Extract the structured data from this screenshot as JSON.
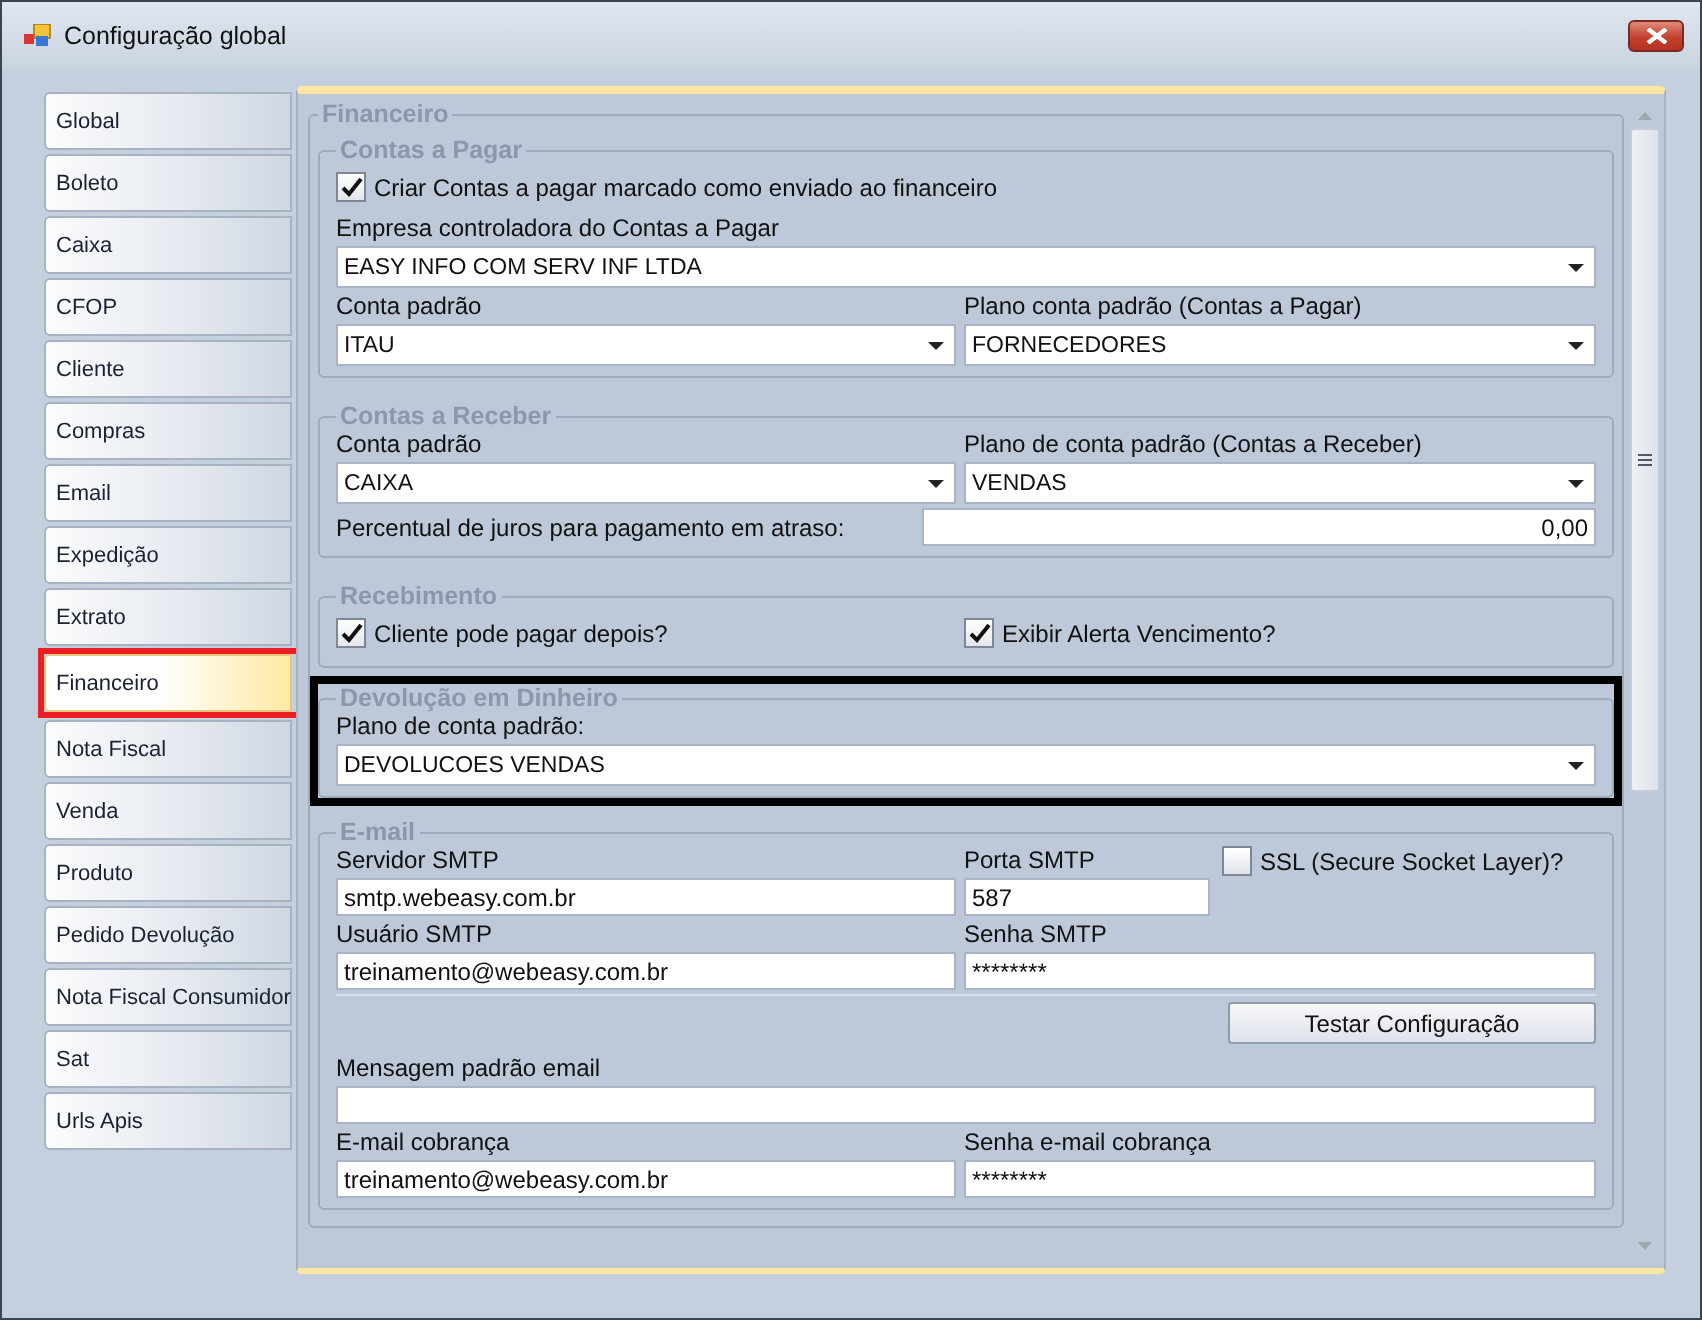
{
  "window": {
    "title": "Configuração global"
  },
  "tabs": [
    {
      "label": "Global",
      "selected": false,
      "marked": false
    },
    {
      "label": "Boleto",
      "selected": false,
      "marked": false
    },
    {
      "label": "Caixa",
      "selected": false,
      "marked": false
    },
    {
      "label": "CFOP",
      "selected": false,
      "marked": false
    },
    {
      "label": "Cliente",
      "selected": false,
      "marked": false
    },
    {
      "label": "Compras",
      "selected": false,
      "marked": false
    },
    {
      "label": "Email",
      "selected": false,
      "marked": false
    },
    {
      "label": "Expedição",
      "selected": false,
      "marked": false
    },
    {
      "label": "Extrato",
      "selected": false,
      "marked": false
    },
    {
      "label": "Financeiro",
      "selected": true,
      "marked": true
    },
    {
      "label": "Nota Fiscal",
      "selected": false,
      "marked": false
    },
    {
      "label": "Venda",
      "selected": false,
      "marked": false
    },
    {
      "label": "Produto",
      "selected": false,
      "marked": false
    },
    {
      "label": "Pedido Devolução",
      "selected": false,
      "marked": false
    },
    {
      "label": "Nota Fiscal Consumidor",
      "selected": false,
      "marked": false
    },
    {
      "label": "Sat",
      "selected": false,
      "marked": false
    },
    {
      "label": "Urls Apis",
      "selected": false,
      "marked": false
    }
  ],
  "panel": {
    "title": "Financeiro",
    "groups": [
      {
        "title": "Contas a Pagar",
        "marked": false,
        "rows": [
          {
            "kind": "single",
            "fields": [
              {
                "kind": "checkbox",
                "label": "Criar Contas a pagar marcado como enviado ao financeiro",
                "checked": true
              }
            ]
          },
          {
            "kind": "single",
            "fields": [
              {
                "kind": "combo",
                "label": "Empresa controladora do Contas a Pagar",
                "value": "EASY INFO COM  SERV INF LTDA"
              }
            ]
          },
          {
            "kind": "pair",
            "fields": [
              {
                "kind": "combo",
                "label": "Conta padrão",
                "value": "ITAU"
              },
              {
                "kind": "combo",
                "label": "Plano conta padrão (Contas a Pagar)",
                "value": "FORNECEDORES"
              }
            ]
          }
        ]
      },
      {
        "title": "Contas a Receber",
        "marked": false,
        "rows": [
          {
            "kind": "pair",
            "fields": [
              {
                "kind": "combo",
                "label": "Conta padrão",
                "value": "CAIXA"
              },
              {
                "kind": "combo",
                "label": "Plano de conta padrão (Contas a Receber)",
                "value": "VENDAS"
              }
            ]
          },
          {
            "kind": "inline",
            "fields": [
              {
                "kind": "number",
                "label": "Percentual de juros para pagamento em atraso:",
                "value": "0,00"
              }
            ]
          }
        ]
      },
      {
        "title": "Recebimento",
        "marked": false,
        "rows": [
          {
            "kind": "pair",
            "fields": [
              {
                "kind": "checkbox",
                "label": "Cliente pode pagar depois?",
                "checked": true
              },
              {
                "kind": "checkbox",
                "label": "Exibir Alerta Vencimento?",
                "checked": true
              }
            ]
          }
        ]
      },
      {
        "title": "Devolução em Dinheiro",
        "marked": true,
        "rows": [
          {
            "kind": "single",
            "fields": [
              {
                "kind": "combo",
                "label": "Plano de conta padrão:",
                "value": "DEVOLUCOES VENDAS"
              }
            ]
          }
        ]
      },
      {
        "title": "E-mail",
        "marked": false,
        "rows": [
          {
            "kind": "triple",
            "fields": [
              {
                "kind": "text",
                "label": "Servidor SMTP",
                "value": "smtp.webeasy.com.br"
              },
              {
                "kind": "text",
                "label": "Porta SMTP",
                "value": "587"
              },
              {
                "kind": "checkbox",
                "label": "SSL (Secure Socket Layer)?",
                "checked": false
              }
            ]
          },
          {
            "kind": "pair",
            "fields": [
              {
                "kind": "text",
                "label": "Usuário SMTP",
                "value": "treinamento@webeasy.com.br"
              },
              {
                "kind": "text",
                "label": "Senha SMTP",
                "value": "********"
              }
            ]
          },
          {
            "kind": "button",
            "fields": [
              {
                "kind": "button",
                "label": "Testar Configuração"
              }
            ]
          },
          {
            "kind": "single",
            "fields": [
              {
                "kind": "text",
                "label": "Mensagem padrão email"
              }
            ]
          },
          {
            "kind": "pair",
            "fields": [
              {
                "kind": "text",
                "label": "E-mail cobrança",
                "value": "treinamento@webeasy.com.br"
              },
              {
                "kind": "text",
                "label": "Senha e-mail cobrança",
                "value": "********"
              }
            ]
          }
        ]
      }
    ]
  }
}
